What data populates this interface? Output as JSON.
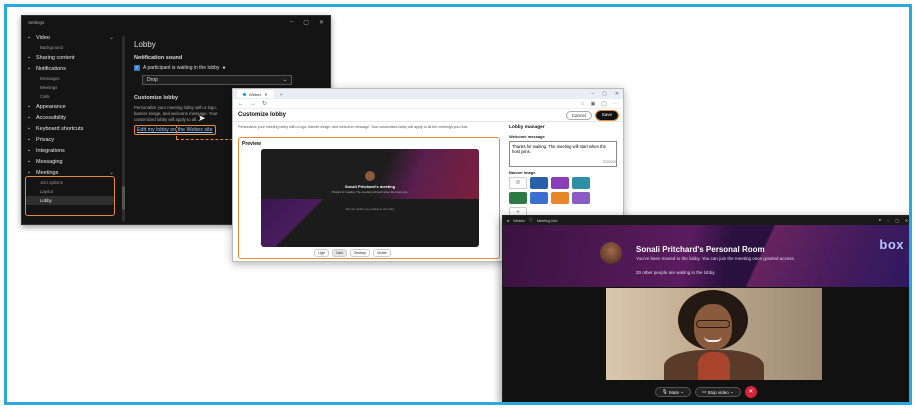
{
  "settings": {
    "title": "Settings",
    "nav": [
      {
        "label": "Video",
        "icon": "video-icon",
        "caret": "⌄",
        "subs": [
          "Background"
        ]
      },
      {
        "label": "Sharing content",
        "icon": "share-icon"
      },
      {
        "label": "Notifications",
        "icon": "bell-icon",
        "subs": [
          "Messages",
          "Meetings",
          "Calls"
        ]
      },
      {
        "label": "Appearance",
        "icon": "appearance-icon"
      },
      {
        "label": "Accessibility",
        "icon": "accessibility-icon"
      },
      {
        "label": "Keyboard shortcuts",
        "icon": "keyboard-icon"
      },
      {
        "label": "Privacy",
        "icon": "privacy-icon"
      },
      {
        "label": "Integrations",
        "icon": "integrations-icon"
      },
      {
        "label": "Messaging",
        "icon": "messaging-icon"
      },
      {
        "label": "Meetings",
        "icon": "meetings-icon",
        "caret": "⌄",
        "subs": [
          "Join options",
          "Layout",
          "Lobby"
        ]
      }
    ],
    "main": {
      "heading": "Lobby",
      "notification_sound_label": "Notification sound",
      "participant_waiting_label": "A participant is waiting in the lobby",
      "sound_value": "Drop",
      "customize_label": "Customize lobby",
      "customize_desc": "Personalize your meeting lobby with a logo, banner image, and welcome message. Your customized lobby will apply to all...",
      "edit_link": "Edit my lobby on the Webex site"
    }
  },
  "browser": {
    "tab_title": "Webex",
    "page_title": "Customize lobby",
    "cancel_label": "Cancel",
    "save_label": "Save",
    "description": "Personalize your meeting lobby with a logo, banner image, and welcome message. Your customized lobby will apply to all the meetings you host.",
    "preview": {
      "label": "Preview",
      "host_name": "Sonali Pritchard's meeting",
      "sub1": "Thanks for waiting. The meeting will start when the host joins.",
      "sub2": "We can update you waiting in the lobby",
      "toggles": [
        "Light",
        "Dark",
        "Desktop",
        "Mobile"
      ]
    },
    "lobby_manager": {
      "heading": "Lobby manager",
      "welcome_label": "Welcome message",
      "welcome_value": "Thanks for waiting. The meeting will start when the host joins.",
      "char_count": "702/1000",
      "banner_label": "Banner image",
      "logo_label": "Display logo"
    },
    "swatch_colors": [
      "#ffffff",
      "#2b5fa8",
      "#8a3fb8",
      "#2e8fa4",
      "#2d7a45",
      "#3a6fd0",
      "#e8862a",
      "#8b5cc4",
      "#ffffff"
    ]
  },
  "lobby": {
    "tabs": [
      "Webex",
      "Meeting info"
    ],
    "room_name": "Sonali Pritchard's Personal Room",
    "status_text": "You've been moved to the lobby. You can join the meeting once granted access.",
    "waiting_text": "20 other people are waiting in the lobby.",
    "brand": "box",
    "mute_label": "Mute",
    "stop_video_label": "Stop video"
  },
  "colors": {
    "accent_highlight": "#e58b3a",
    "frame_border": "#2aa9e0",
    "end_call": "#d2233a"
  }
}
